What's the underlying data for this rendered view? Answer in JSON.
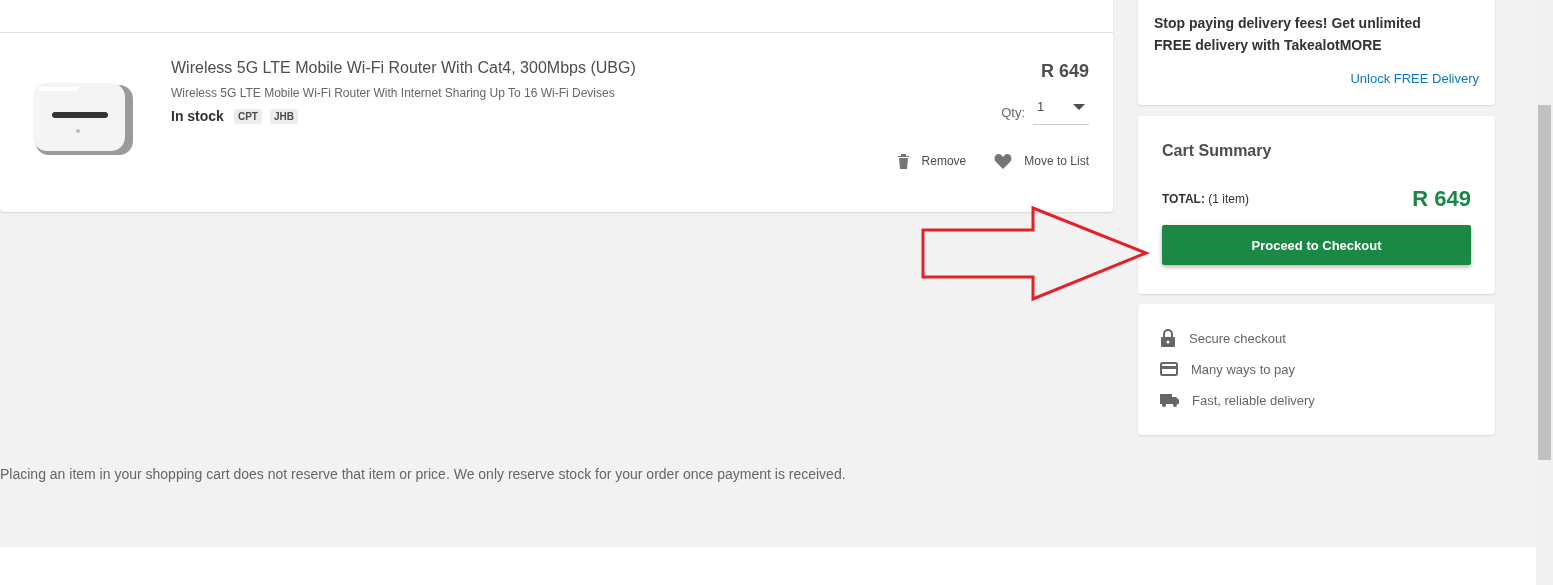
{
  "cart_item": {
    "title": "Wireless 5G LTE Mobile Wi-Fi Router With Cat4, 300Mbps (UBG)",
    "subtitle": "Wireless 5G LTE Mobile Wi-Fi Router With Internet Sharing Up To 16 Wi-Fi Devises",
    "stock": "In stock",
    "warehouses": [
      "CPT",
      "JHB"
    ],
    "price": "R 649",
    "qty_label": "Qty:",
    "qty": "1",
    "actions": [
      {
        "kind": "remove",
        "label": "Remove"
      },
      {
        "kind": "list",
        "label": "Move to List"
      }
    ]
  },
  "disclaimer": "Placing an item in your shopping cart does not reserve that item or price. We only reserve stock for your order once payment is received.",
  "promo": {
    "text": "Stop paying delivery fees! Get unlimited FREE delivery with TakealotMORE",
    "link": "Unlock FREE Delivery"
  },
  "summary": {
    "title": "Cart Summary",
    "total_label": "TOTAL:",
    "count": "(1 item)",
    "total": "R 649",
    "button": "Proceed to Checkout"
  },
  "trust": [
    {
      "kind": "lock",
      "label": "Secure checkout"
    },
    {
      "kind": "card",
      "label": "Many ways to pay"
    },
    {
      "kind": "truck",
      "label": "Fast, reliable delivery"
    }
  ]
}
